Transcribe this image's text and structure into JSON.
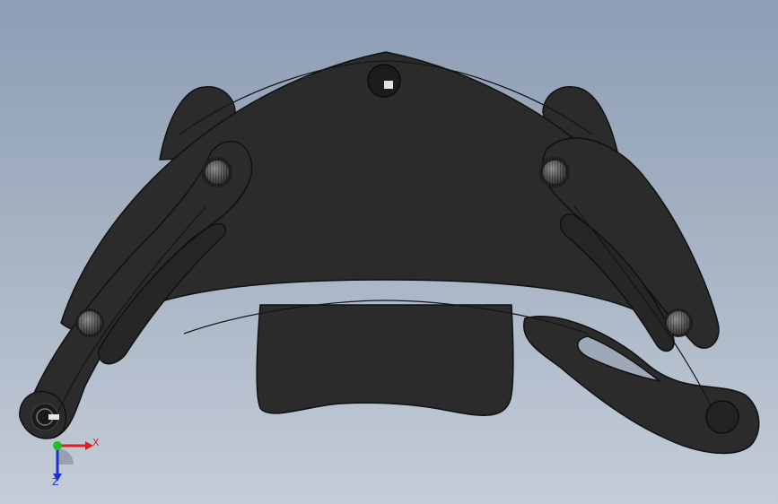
{
  "viewport": {
    "background_top": "#8d9db4",
    "background_bottom": "#c4ccd8"
  },
  "model": {
    "part_color": "#2b2b2b",
    "edge_color": "#111111",
    "pin_color": "#7a7a7a"
  },
  "triad": {
    "x_label": "X",
    "z_label": "Z",
    "x_color": "#e02020",
    "y_color": "#20c020",
    "z_color": "#2030d0"
  }
}
